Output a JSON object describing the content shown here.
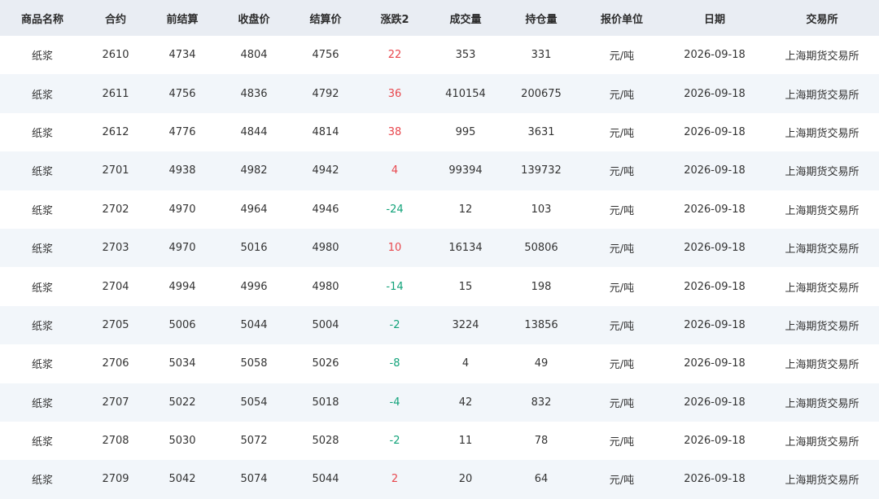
{
  "colors": {
    "header_bg": "#e9edf3",
    "row_alt_bg": "#f2f6fa",
    "up": "#e8474d",
    "down": "#12a37a",
    "text": "#333333"
  },
  "table": {
    "headers": [
      "商品名称",
      "合约",
      "前结算",
      "收盘价",
      "结算价",
      "涨跌2",
      "成交量",
      "持仓量",
      "报价单位",
      "日期",
      "交易所"
    ],
    "rows": [
      [
        "纸浆",
        "2610",
        "4734",
        "4804",
        "4756",
        "22",
        "353",
        "331",
        "元/吨",
        "2026-09-18",
        "上海期货交易所"
      ],
      [
        "纸浆",
        "2611",
        "4756",
        "4836",
        "4792",
        "36",
        "410154",
        "200675",
        "元/吨",
        "2026-09-18",
        "上海期货交易所"
      ],
      [
        "纸浆",
        "2612",
        "4776",
        "4844",
        "4814",
        "38",
        "995",
        "3631",
        "元/吨",
        "2026-09-18",
        "上海期货交易所"
      ],
      [
        "纸浆",
        "2701",
        "4938",
        "4982",
        "4942",
        "4",
        "99394",
        "139732",
        "元/吨",
        "2026-09-18",
        "上海期货交易所"
      ],
      [
        "纸浆",
        "2702",
        "4970",
        "4964",
        "4946",
        "-24",
        "12",
        "103",
        "元/吨",
        "2026-09-18",
        "上海期货交易所"
      ],
      [
        "纸浆",
        "2703",
        "4970",
        "5016",
        "4980",
        "10",
        "16134",
        "50806",
        "元/吨",
        "2026-09-18",
        "上海期货交易所"
      ],
      [
        "纸浆",
        "2704",
        "4994",
        "4996",
        "4980",
        "-14",
        "15",
        "198",
        "元/吨",
        "2026-09-18",
        "上海期货交易所"
      ],
      [
        "纸浆",
        "2705",
        "5006",
        "5044",
        "5004",
        "-2",
        "3224",
        "13856",
        "元/吨",
        "2026-09-18",
        "上海期货交易所"
      ],
      [
        "纸浆",
        "2706",
        "5034",
        "5058",
        "5026",
        "-8",
        "4",
        "49",
        "元/吨",
        "2026-09-18",
        "上海期货交易所"
      ],
      [
        "纸浆",
        "2707",
        "5022",
        "5054",
        "5018",
        "-4",
        "42",
        "832",
        "元/吨",
        "2026-09-18",
        "上海期货交易所"
      ],
      [
        "纸浆",
        "2708",
        "5030",
        "5072",
        "5028",
        "-2",
        "11",
        "78",
        "元/吨",
        "2026-09-18",
        "上海期货交易所"
      ],
      [
        "纸浆",
        "2709",
        "5042",
        "5074",
        "5044",
        "2",
        "20",
        "64",
        "元/吨",
        "2026-09-18",
        "上海期货交易所"
      ]
    ]
  }
}
